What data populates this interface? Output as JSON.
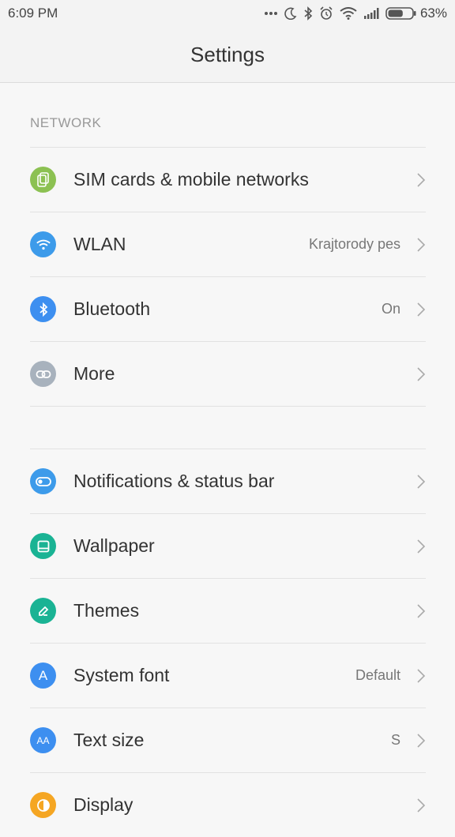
{
  "status_bar": {
    "time": "6:09 PM",
    "battery_percent": "63%",
    "battery_level": 0.63,
    "icons": [
      "more-dots-icon",
      "moon-icon",
      "bluetooth-icon",
      "alarm-icon",
      "wifi-icon",
      "signal-icon",
      "battery-icon"
    ]
  },
  "header": {
    "title": "Settings"
  },
  "sections": {
    "network_title": "NETWORK"
  },
  "network_items": [
    {
      "label": "SIM cards & mobile networks",
      "value": "",
      "icon": "sim-card-icon",
      "color": "#8cc152"
    },
    {
      "label": "WLAN",
      "value": "Krajtorody pes",
      "icon": "wifi-icon",
      "color": "#3d9bea"
    },
    {
      "label": "Bluetooth",
      "value": "On",
      "icon": "bluetooth-icon",
      "color": "#3d8ff0"
    },
    {
      "label": "More",
      "value": "",
      "icon": "link-icon",
      "color": "#a8b2bd"
    }
  ],
  "system_items": [
    {
      "label": "Notifications & status bar",
      "value": "",
      "icon": "toggle-icon",
      "color": "#3d9bea"
    },
    {
      "label": "Wallpaper",
      "value": "",
      "icon": "wallpaper-icon",
      "color": "#1ab394"
    },
    {
      "label": "Themes",
      "value": "",
      "icon": "brush-icon",
      "color": "#1ab394"
    },
    {
      "label": "System font",
      "value": "Default",
      "icon": "font-icon",
      "color": "#3d8ff0",
      "glyph": "A"
    },
    {
      "label": "Text size",
      "value": "S",
      "icon": "text-size-icon",
      "color": "#3d8ff0",
      "glyph": "AA"
    },
    {
      "label": "Display",
      "value": "",
      "icon": "display-icon",
      "color": "#f5a623"
    }
  ]
}
